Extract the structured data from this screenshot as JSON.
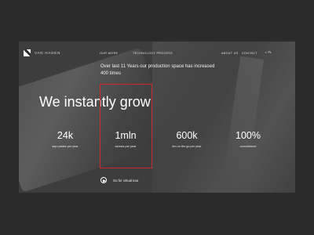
{
  "brand": {
    "name": "VAN HADEN"
  },
  "nav": {
    "left_links": [
      "OUR WORK",
      "TECHNOLOGY PROCESS"
    ],
    "right_links": [
      "ABOUT US",
      "CONTACT"
    ],
    "language": "PL"
  },
  "hero": {
    "subheading": "Over last 11 Years our production space has increased 400 times",
    "headline": "We instantly grow"
  },
  "stats": [
    {
      "value": "24k",
      "label": "sqm plates per year"
    },
    {
      "value": "1mln",
      "label": "screws per year"
    },
    {
      "value": "600k",
      "label": "km on the go per year"
    },
    {
      "value": "100%",
      "label": "commitment"
    }
  ],
  "cta": {
    "label": "Go for virtual tour"
  },
  "colors": {
    "highlight": "#d22a2a",
    "page_background": "#2b2b2b"
  }
}
